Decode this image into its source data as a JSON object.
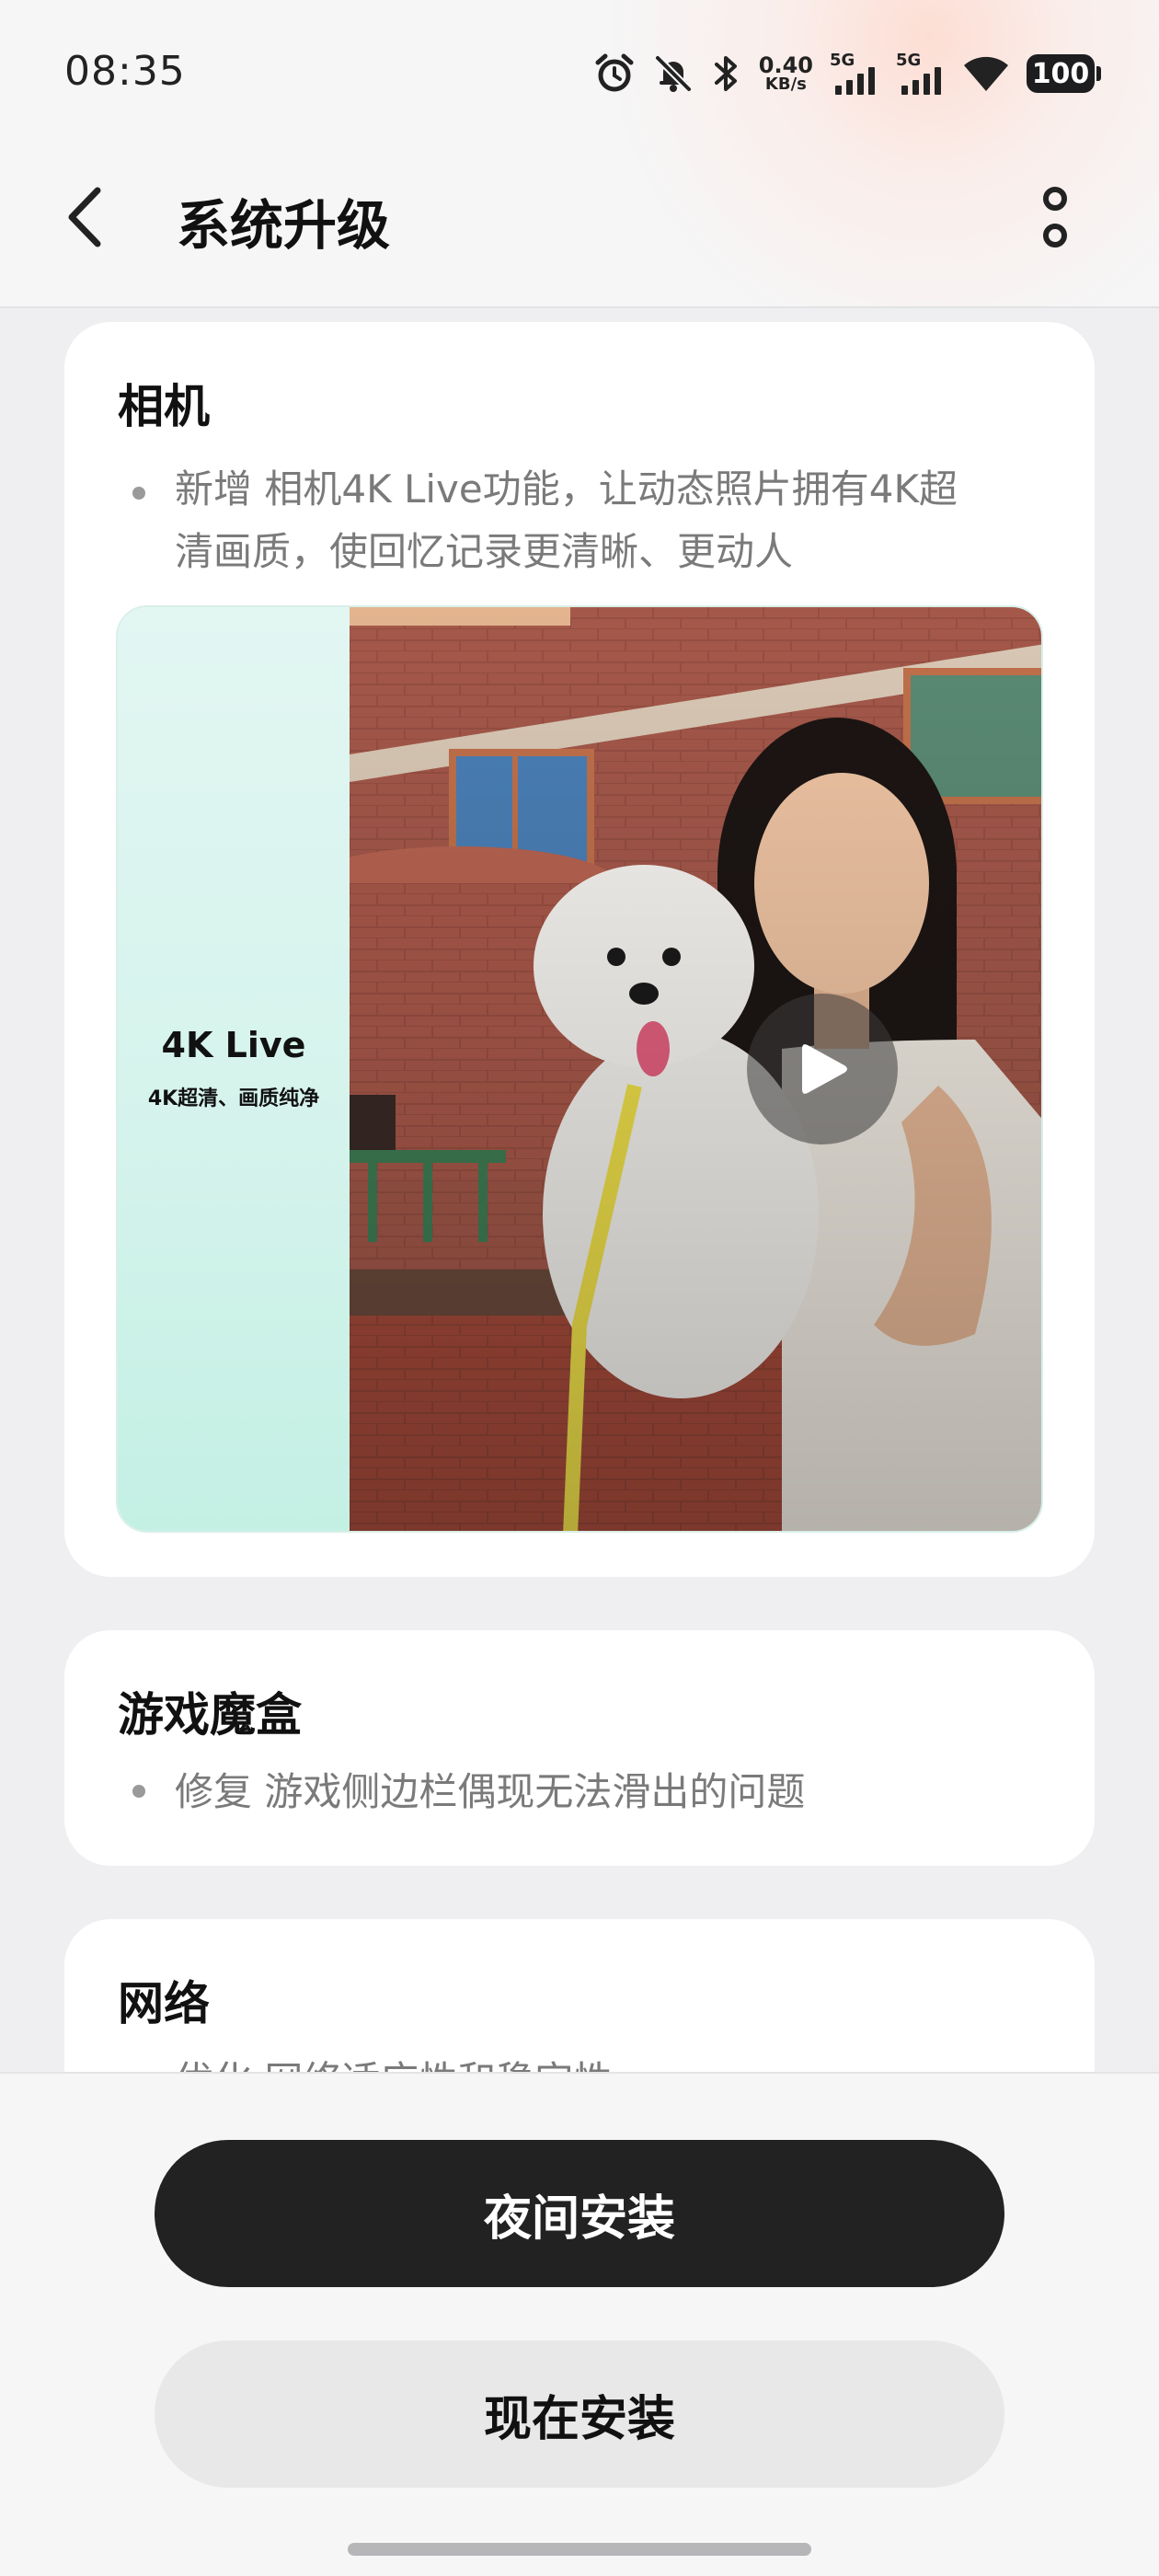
{
  "status_bar": {
    "time": "08:35",
    "net_speed_value": "0.40",
    "net_speed_unit": "KB/s",
    "sim1_label": "5G",
    "sim2_label": "5G",
    "battery": "100",
    "icons": [
      "alarm-icon",
      "mute-bell-icon",
      "bluetooth-icon",
      "signal-icon",
      "wifi-icon",
      "battery-icon"
    ]
  },
  "header": {
    "title": "系统升级",
    "back_icon": "chevron-left-icon",
    "more_icon": "more-vertical-icon"
  },
  "sections": [
    {
      "title": "相机",
      "items": [
        "新增 相机4K Live功能，让动态照片拥有4K超",
        "清画质，使回忆记录更清晰、更动人"
      ],
      "banner": {
        "headline": "4K Live",
        "subline": "4K超清、画质纯净",
        "play_icon": "play-icon"
      }
    },
    {
      "title": "游戏魔盒",
      "items": [
        "修复 游戏侧边栏偶现无法滑出的问题"
      ]
    },
    {
      "title": "网络",
      "items": [
        "优化 网络适应性和稳定性"
      ]
    }
  ],
  "actions": {
    "night_install": "夜间安装",
    "install_now": "现在安装"
  },
  "colors": {
    "background": "#efeff1",
    "card": "#ffffff",
    "primary_button": "#222222",
    "secondary_button": "#e8e8e9",
    "secondary_text": "#7a7a7a",
    "banner_accent": "#c4f0e4"
  }
}
